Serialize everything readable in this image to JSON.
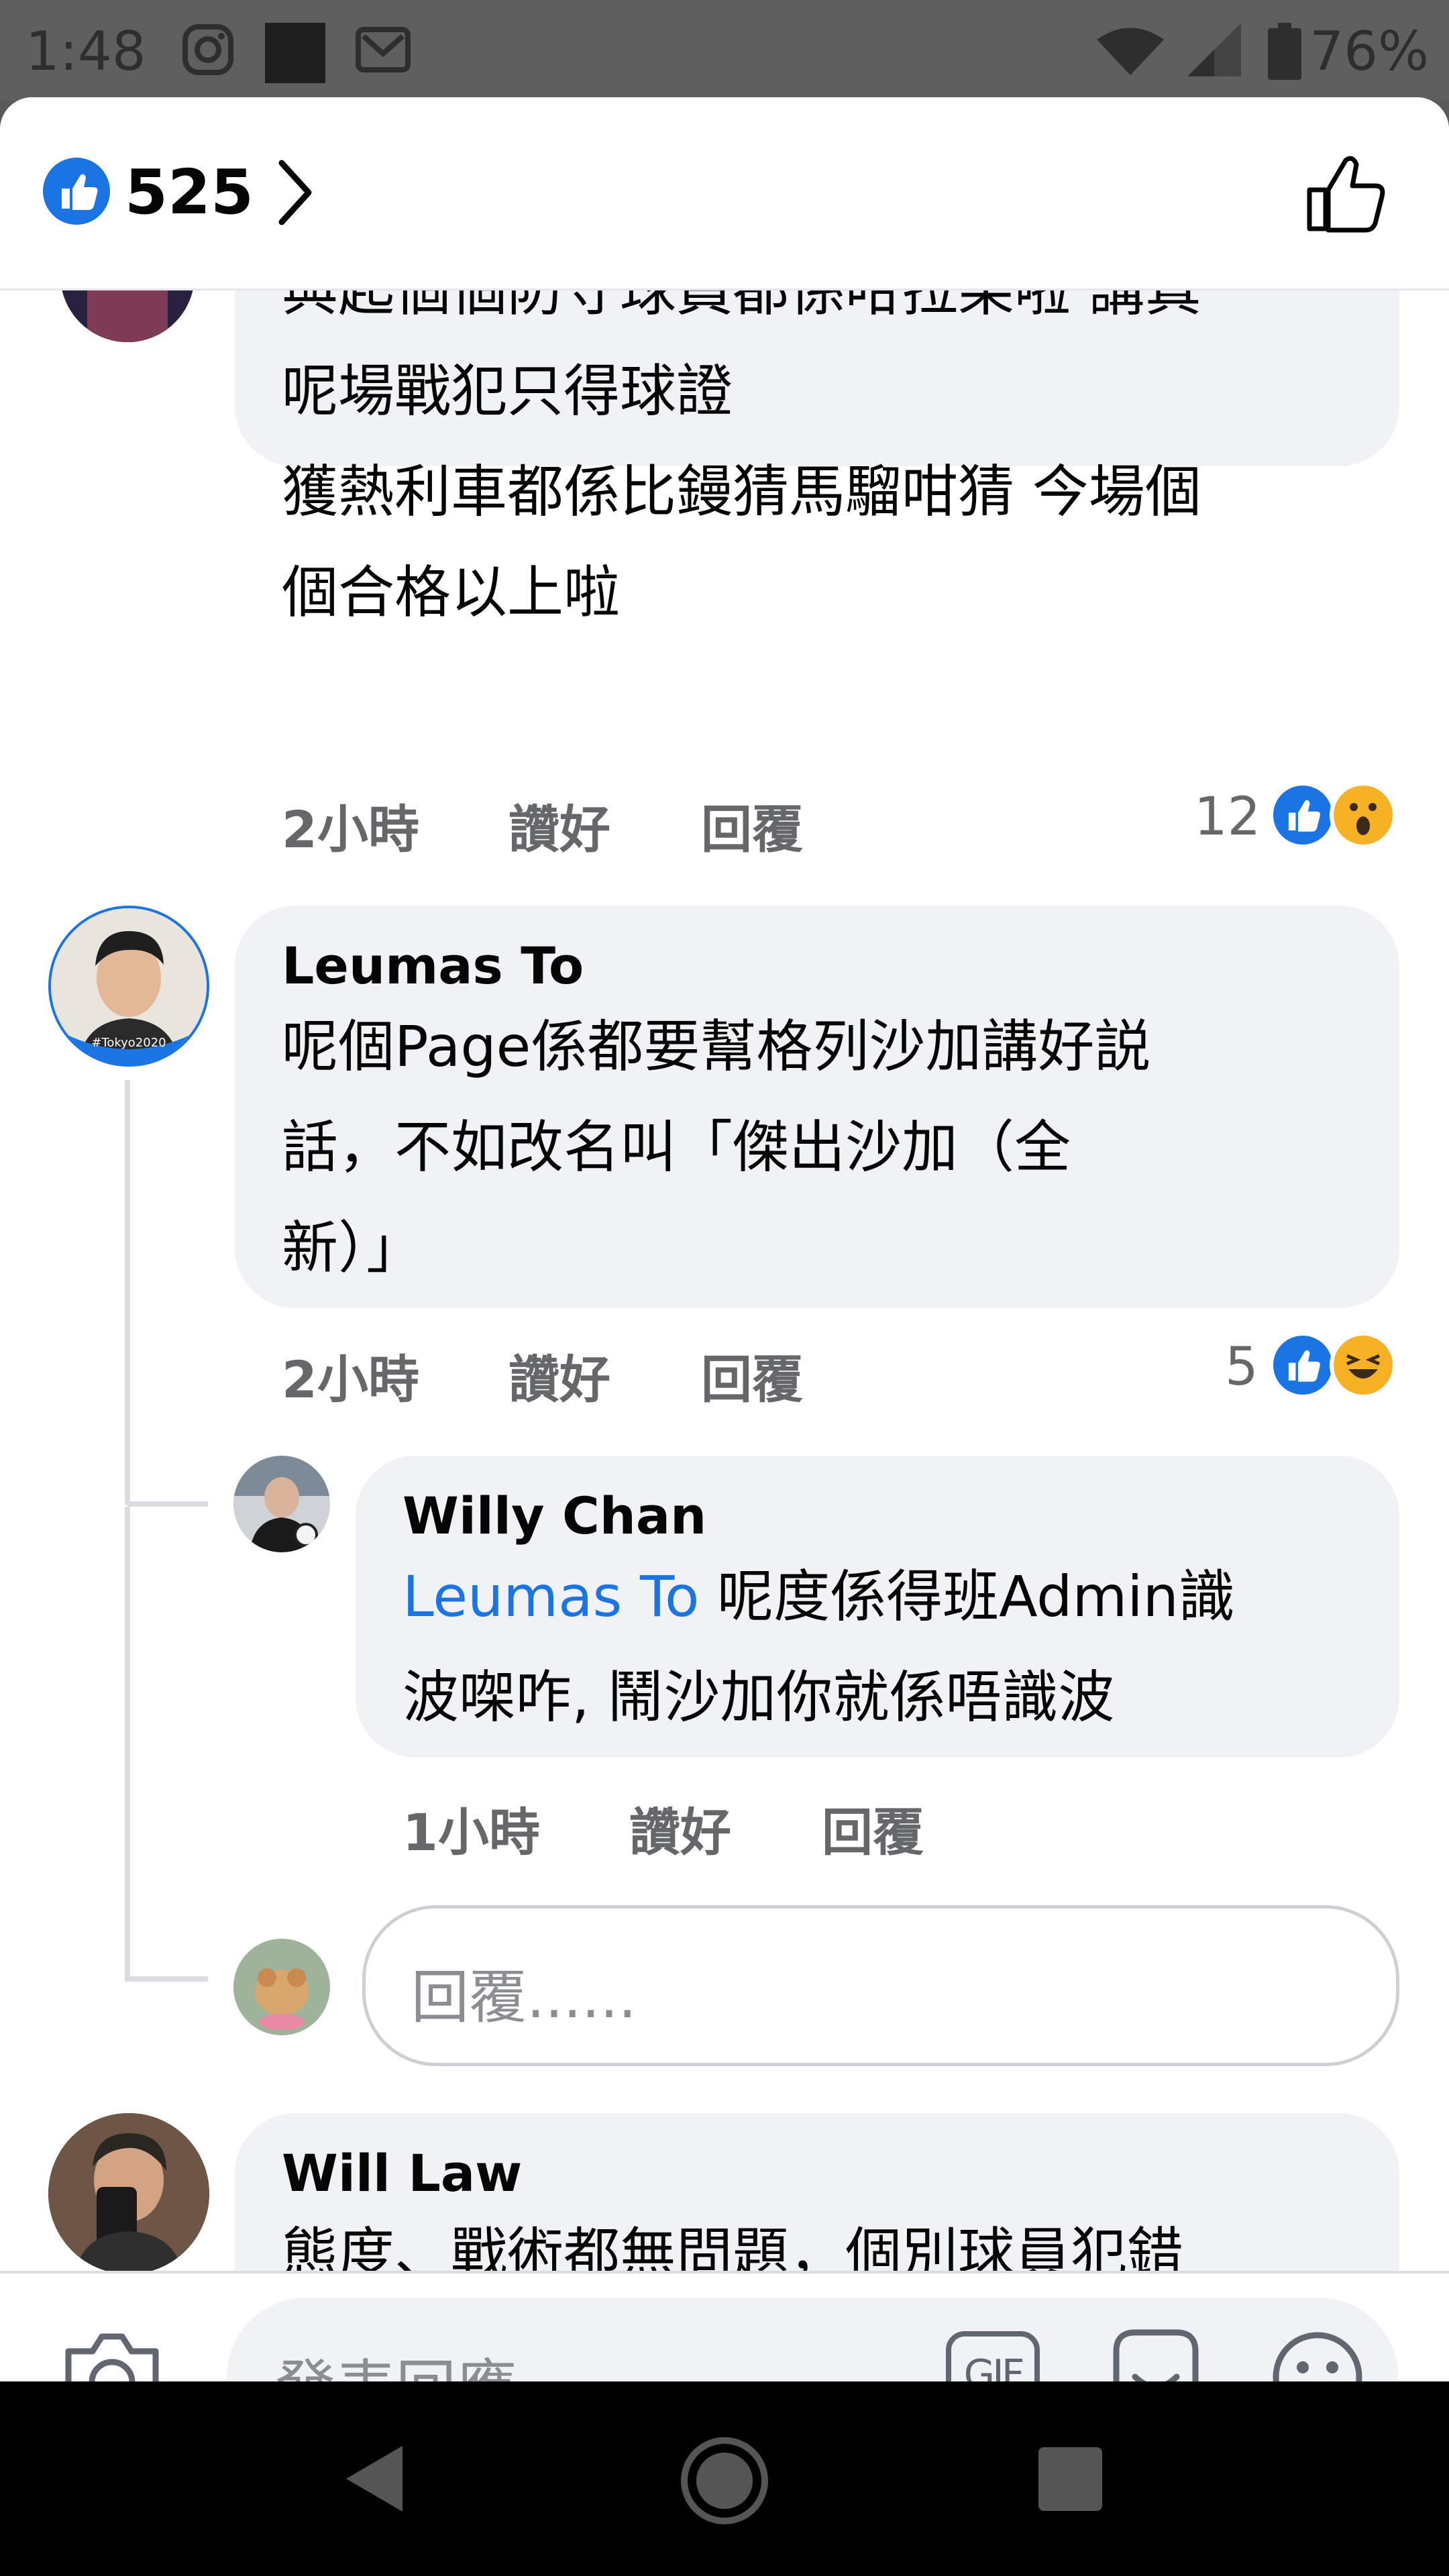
{
  "status_bar": {
    "time": "1:48",
    "battery": "76%"
  },
  "header": {
    "like_count": "525"
  },
  "comments": [
    {
      "lines": [
        "與起個個防守球員都係咁拉柴啦 講真",
        "呢場戰犯只得球證",
        "獲熱利車都係比鏝猜馬騮咁猜 今場個",
        "個合格以上啦"
      ],
      "time": "2小時",
      "like": "讚好",
      "reply": "回覆",
      "reaction_count": "12"
    },
    {
      "name": "Leumas To",
      "avatar_badge": "#Tokyo2020",
      "lines": [
        "呢個Page係都要幫格列沙加講好説",
        "話，不如改名叫「傑出沙加（全",
        "新）」"
      ],
      "time": "2小時",
      "like": "讚好",
      "reply": "回覆",
      "reaction_count": "5"
    },
    {
      "name": "Willy Chan",
      "mention": "Leumas To",
      "line1_rest": " 呢度係得班Admin識",
      "line2": "波㗎咋, 鬧沙加你就係唔識波",
      "time": "1小時",
      "like": "讚好",
      "reply": "回覆"
    },
    {
      "name": "Will Law",
      "lines": [
        "態度、戰術都無問題，個別球員犯錯"
      ]
    }
  ],
  "reply_input": {
    "placeholder": "回覆......"
  },
  "footer": {
    "placeholder": "發表回應......",
    "gif_label": "GIF"
  },
  "colors": {
    "accent": "#1b74e4",
    "bubble": "#f0f2f5",
    "meta": "#65676b"
  }
}
